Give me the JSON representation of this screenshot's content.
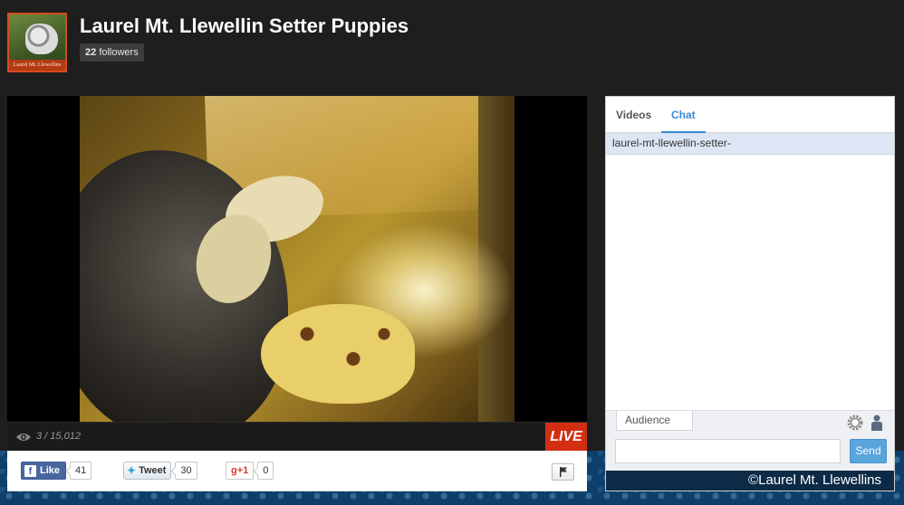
{
  "channel": {
    "title": "Laurel Mt. Llewellin Setter Puppies",
    "followers_count": "22",
    "followers_label": "followers",
    "avatar_caption": "Laurel Mt. Llewellins"
  },
  "player": {
    "viewer_count": "3 / 15,012",
    "live_label": "LIVE"
  },
  "social": {
    "like_label": "Like",
    "like_count": "41",
    "tweet_label": "Tweet",
    "tweet_count": "30",
    "gplus_label": "+1",
    "gplus_count": "0"
  },
  "chat": {
    "tabs": [
      {
        "label": "Videos",
        "active": false
      },
      {
        "label": "Chat",
        "active": true
      }
    ],
    "channel_name": "laurel-mt-llewellin-setter-",
    "audience_label": "Audience",
    "input_value": "",
    "send_label": "Send",
    "watermark": "©Laurel Mt. Llewellins"
  },
  "colors": {
    "live_red": "#d32e12",
    "chat_accent": "#3a88d4",
    "send_button": "#5aa4dc",
    "facebook_blue": "#3b5998"
  }
}
